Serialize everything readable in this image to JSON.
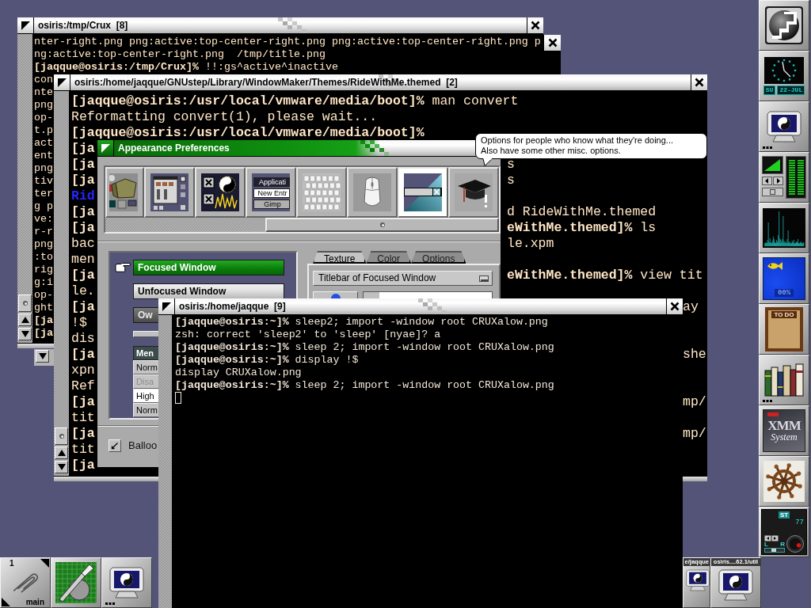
{
  "crux_terminal": {
    "title": "osiris:/tmp/Crux  [8]",
    "focused": false,
    "lines": [
      {
        "text": "nter-right.png png:active:top-center-right.png png:active:top-center-right.png p",
        "bold": false
      },
      {
        "text": "ng:active:top-center-right.png  /tmp/title.png",
        "bold": false
      },
      {
        "text": "**[jaqque@osiris:/tmp/Crux]%** !!:gs^active^inactive",
        "bold": false
      },
      {
        "text": "con",
        "bold": false
      },
      {
        "text": "nte",
        "bold": false
      },
      {
        "text": "png",
        "bold": false
      },
      {
        "text": "op-",
        "bold": false
      },
      {
        "text": "t.p",
        "bold": false
      },
      {
        "text": "act",
        "bold": false
      },
      {
        "text": "ent",
        "bold": false
      },
      {
        "text": "png",
        "bold": false
      },
      {
        "text": "tiv",
        "bold": false
      },
      {
        "text": "ter",
        "bold": false
      },
      {
        "text": "g p",
        "bold": false
      },
      {
        "text": "ve:",
        "bold": false
      },
      {
        "text": "r-r",
        "bold": false
      },
      {
        "text": "png",
        "bold": false
      },
      {
        "text": ":to",
        "bold": false
      },
      {
        "text": "rig",
        "bold": false
      },
      {
        "text": "g:i",
        "bold": false
      },
      {
        "text": "op-",
        "bold": false
      },
      {
        "text": "ght",
        "bold": false
      },
      {
        "text": "[ja",
        "bold": true
      },
      {
        "text": "[ja",
        "bold": true
      }
    ]
  },
  "themes_terminal": {
    "title": "osiris:/home/jaqque/GNUstep/Library/WindowMaker/Themes/RideWithMe.themed  [2]",
    "focused": false,
    "lines": [
      {
        "left": "**[jaqque@osiris:/usr/local/vmware/media/boot]%** man convert",
        "bold": false
      },
      {
        "left": "Reformatting convert(1), please wait...",
        "bold": false
      },
      {
        "left": "[jaqque@osiris:/usr/local/vmware/media/boot]%",
        "bold": true
      },
      {
        "left": "[ja",
        "bold": true
      },
      {
        "left": "[ja",
        "bold": true,
        "right": "s"
      },
      {
        "left": "[ja",
        "bold": true,
        "right": "s"
      },
      {
        "left": "Rid",
        "bold": true,
        "color": "#2626ff"
      },
      {
        "left": "[ja",
        "bold": true,
        "right": "d RideWithMe.themed"
      },
      {
        "left": "[ja",
        "bold": true,
        "right": "**eWithMe.themed]%** ls"
      },
      {
        "left": "bac",
        "bold": false,
        "right": "le.xpm"
      },
      {
        "left": "men",
        "bold": false
      },
      {
        "left": "[ja",
        "bold": true,
        "right": "**eWithMe.themed]%** view tit"
      },
      {
        "left": "le.",
        "bold": false
      },
      {
        "left": "[ja",
        "bold": true,
        "edge": "ay"
      },
      {
        "left": "!$",
        "bold": false
      },
      {
        "left": "dis",
        "bold": false
      },
      {
        "left": "[ja",
        "bold": true,
        "edge": "she"
      },
      {
        "left": "xpn",
        "bold": false
      },
      {
        "left": "Ref",
        "bold": false
      },
      {
        "left": "[ja",
        "bold": true,
        "edge": "mp/"
      },
      {
        "left": "tit",
        "bold": false
      },
      {
        "left": "[ja",
        "bold": true,
        "edge": "mp/"
      },
      {
        "left": "tit",
        "bold": false
      },
      {
        "left": "[ja",
        "bold": true
      }
    ]
  },
  "prefs_window": {
    "title": "Appearance Preferences",
    "focused": true,
    "sections": [
      {
        "kind": "misc",
        "selected": false
      },
      {
        "kind": "windows",
        "selected": false
      },
      {
        "kind": "decorations",
        "selected": false
      },
      {
        "kind": "menu",
        "selected": false,
        "labels": [
          "Applicati",
          "New Entr",
          "Gimp"
        ]
      },
      {
        "kind": "keyboard",
        "selected": false
      },
      {
        "kind": "mouse",
        "selected": false
      },
      {
        "kind": "appearance",
        "selected": true
      },
      {
        "kind": "expert",
        "selected": false
      }
    ],
    "title_styles": [
      {
        "kind": "focused",
        "label": "Focused Window",
        "selected": true
      },
      {
        "kind": "unfocused",
        "label": "Unfocused Window",
        "selected": false
      },
      {
        "kind": "owner",
        "label": "Ow",
        "selected": false
      }
    ],
    "menu_preview": [
      {
        "kind": "title",
        "label": "Men"
      },
      {
        "kind": "normal",
        "label": "Norm"
      },
      {
        "kind": "disabled",
        "label": "Disa"
      },
      {
        "kind": "highlighted",
        "label": "High"
      },
      {
        "kind": "normal",
        "label": "Norm"
      }
    ],
    "tabs": [
      {
        "label": "Texture",
        "selected": true
      },
      {
        "label": "Color",
        "selected": false
      },
      {
        "label": "Options",
        "selected": false
      }
    ],
    "texture_target": {
      "value": "Titlebar of Focused Window"
    },
    "balloon_option": {
      "label": "Balloo",
      "checked": true
    }
  },
  "tooltip": {
    "text": "Options for people who know what they're doing...\nAlso have some other misc. options."
  },
  "home_terminal": {
    "title": "osiris:/home/jaqque  [9]",
    "focused": false,
    "lines": [
      "**[jaqque@osiris:~]%** sleep2; import -window root CRUXalow.png",
      "zsh: correct 'sleep2' to 'sleep' [nyae]? a",
      "**[jaqque@osiris:~]%** sleep 2; import -window root CRUXalow.png",
      "**[jaqque@osiris:~]%** display !$",
      "display CRUXalow.png",
      "**[jaqque@osiris:~]%** sleep 2; import -window root CRUXalow.png"
    ]
  },
  "dock": [
    {
      "kind": "logo",
      "running": true
    },
    {
      "kind": "clock",
      "running": true,
      "day": "SU",
      "date": "22-JUL"
    },
    {
      "kind": "monitor",
      "running": false
    },
    {
      "kind": "mixer",
      "running": true
    },
    {
      "kind": "load",
      "running": true
    },
    {
      "kind": "fish",
      "running": true,
      "reading": "00%"
    },
    {
      "kind": "todo",
      "running": true,
      "label": "TO DO"
    },
    {
      "kind": "books",
      "running": false
    },
    {
      "kind": "xmm",
      "running": true,
      "title": "XMM",
      "subtitle": "System"
    },
    {
      "kind": "wheel",
      "running": true
    },
    {
      "kind": "player",
      "running": true,
      "mode": "ST",
      "track": "77",
      "left": "L",
      "right": "R",
      "level": 0.45
    }
  ],
  "clip": {
    "workspace": "1",
    "name": "main"
  },
  "bottom_apps": [
    {
      "kind": "prefs",
      "running": true
    },
    {
      "kind": "monitor",
      "running": false
    }
  ],
  "miniwindows": [
    {
      "label": "e/jaqque"
    },
    {
      "label": "osiris....62.1/util"
    }
  ]
}
